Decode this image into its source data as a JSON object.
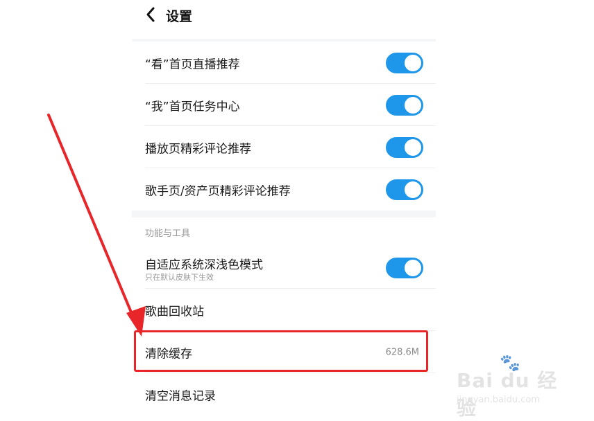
{
  "header": {
    "title": "设置"
  },
  "group1": {
    "items": [
      {
        "label": "“看”首页直播推荐",
        "enabled": true
      },
      {
        "label": "“我”首页任务中心",
        "enabled": true
      },
      {
        "label": "播放页精彩评论推荐",
        "enabled": true
      },
      {
        "label": "歌手页/资产页精彩评论推荐",
        "enabled": true
      }
    ]
  },
  "group2": {
    "header": "功能与工具",
    "dark_mode": {
      "label": "自适应系统深浅色模式",
      "sub": "只在默认皮肤下生效",
      "enabled": true
    },
    "recycle": {
      "label": "歌曲回收站"
    },
    "clear_cache": {
      "label": "清除缓存",
      "value": "628.6M"
    },
    "clear_messages": {
      "label": "清空消息记录"
    }
  },
  "watermark": {
    "brand": "Bai  du 经验",
    "url": "jingyan.baidu.com"
  },
  "colors": {
    "toggle_on": "#1e97ea",
    "highlight": "#e8262a",
    "background": "#f5f6f8"
  }
}
